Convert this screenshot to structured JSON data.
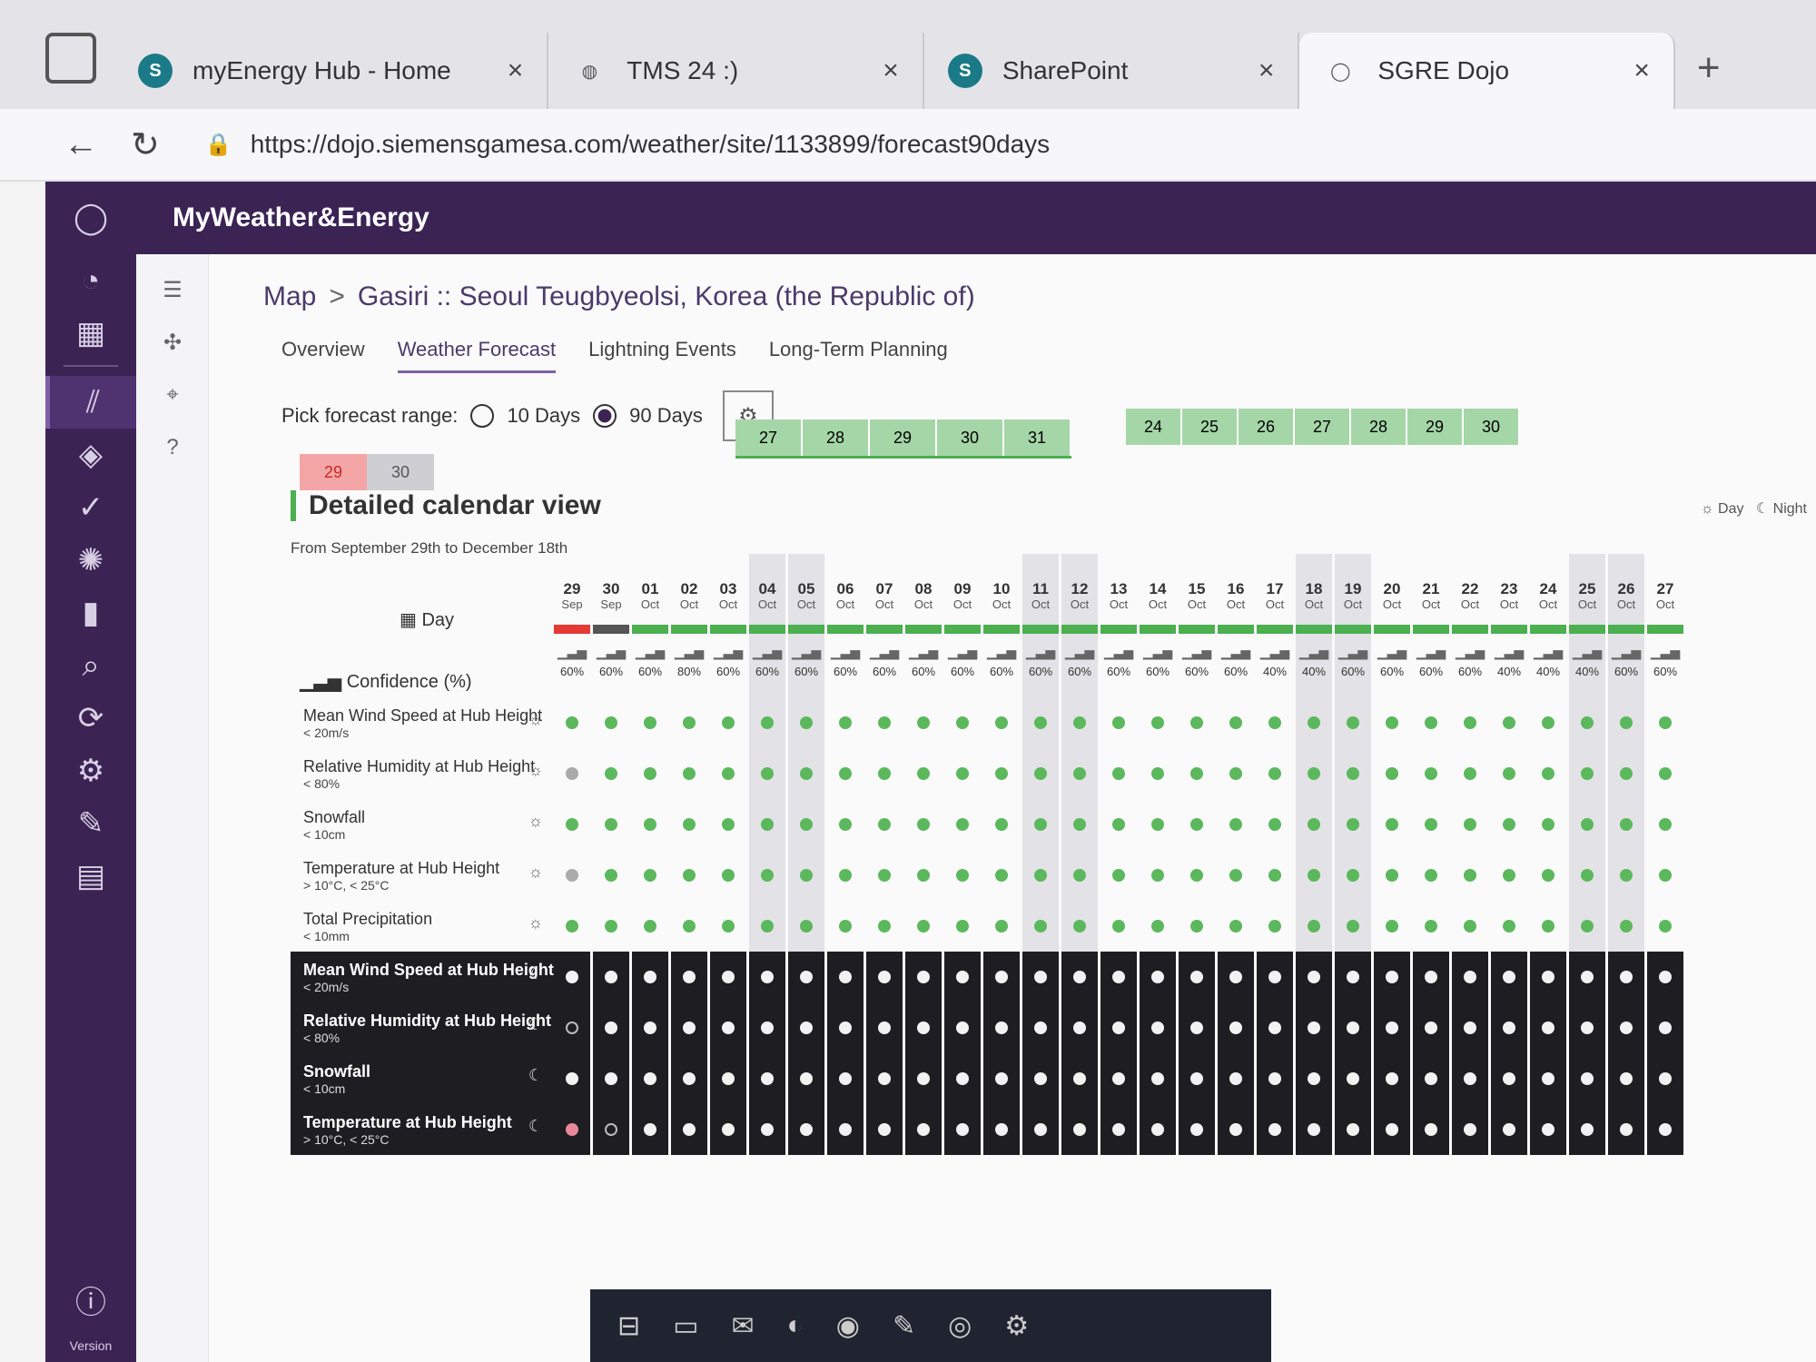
{
  "browser": {
    "tabs": [
      {
        "title": "myEnergy Hub - Home",
        "icon": "sharepoint-icon",
        "color": "#1b7a88"
      },
      {
        "title": "TMS 24 :)",
        "icon": "globe-icon",
        "color": "#555555"
      },
      {
        "title": "SharePoint",
        "icon": "sharepoint-icon",
        "color": "#1b7a88"
      },
      {
        "title": "SGRE Dojo",
        "icon": "dojo-icon",
        "color": "#555555"
      }
    ],
    "url": "https://dojo.siemensgamesa.com/weather/site/1133899/forecast90days"
  },
  "app": {
    "title": "MyWeather&Energy",
    "version_label": "Version",
    "breadcrumb": {
      "root": "Map",
      "current": "Gasiri :: Seoul Teugbyeolsi, Korea (the Republic of)"
    },
    "tabs": [
      "Overview",
      "Weather Forecast",
      "Lightning Events",
      "Long-Term Planning"
    ],
    "active_tab": "Weather Forecast",
    "range": {
      "label": "Pick forecast range:",
      "opt10": "10 Days",
      "opt90": "90 Days",
      "selected": "90 Days"
    },
    "mini_calendar": {
      "sep": [
        "29",
        "30"
      ],
      "oct": [
        "27",
        "28",
        "29",
        "30",
        "31"
      ],
      "nov": [
        "24",
        "25",
        "26",
        "27",
        "28",
        "29",
        "30"
      ]
    },
    "section_title": "Detailed calendar view",
    "range_text": "From September 29th to December 18th",
    "legend": {
      "day": "Day",
      "night": "Night"
    },
    "day_label": "Day",
    "confidence_label": "Confidence (%)",
    "colors": {
      "green": "#4caf50",
      "red": "#e53935",
      "grey": "#555555",
      "purple": "#3b2454"
    }
  },
  "days": [
    {
      "d": "29",
      "m": "Sep",
      "conf": "60%",
      "bar": "red"
    },
    {
      "d": "30",
      "m": "Sep",
      "conf": "60%",
      "bar": "grey"
    },
    {
      "d": "01",
      "m": "Oct",
      "conf": "60%",
      "bar": "green"
    },
    {
      "d": "02",
      "m": "Oct",
      "conf": "80%",
      "bar": "green"
    },
    {
      "d": "03",
      "m": "Oct",
      "conf": "60%",
      "bar": "green"
    },
    {
      "d": "04",
      "m": "Oct",
      "conf": "60%",
      "bar": "green",
      "weekend": true
    },
    {
      "d": "05",
      "m": "Oct",
      "conf": "60%",
      "bar": "green",
      "weekend": true
    },
    {
      "d": "06",
      "m": "Oct",
      "conf": "60%",
      "bar": "green"
    },
    {
      "d": "07",
      "m": "Oct",
      "conf": "60%",
      "bar": "green"
    },
    {
      "d": "08",
      "m": "Oct",
      "conf": "60%",
      "bar": "green"
    },
    {
      "d": "09",
      "m": "Oct",
      "conf": "60%",
      "bar": "green"
    },
    {
      "d": "10",
      "m": "Oct",
      "conf": "60%",
      "bar": "green"
    },
    {
      "d": "11",
      "m": "Oct",
      "conf": "60%",
      "bar": "green",
      "weekend": true
    },
    {
      "d": "12",
      "m": "Oct",
      "conf": "60%",
      "bar": "green",
      "weekend": true
    },
    {
      "d": "13",
      "m": "Oct",
      "conf": "60%",
      "bar": "green"
    },
    {
      "d": "14",
      "m": "Oct",
      "conf": "60%",
      "bar": "green"
    },
    {
      "d": "15",
      "m": "Oct",
      "conf": "60%",
      "bar": "green"
    },
    {
      "d": "16",
      "m": "Oct",
      "conf": "60%",
      "bar": "green"
    },
    {
      "d": "17",
      "m": "Oct",
      "conf": "40%",
      "bar": "green"
    },
    {
      "d": "18",
      "m": "Oct",
      "conf": "40%",
      "bar": "green",
      "weekend": true
    },
    {
      "d": "19",
      "m": "Oct",
      "conf": "60%",
      "bar": "green",
      "weekend": true
    },
    {
      "d": "20",
      "m": "Oct",
      "conf": "60%",
      "bar": "green"
    },
    {
      "d": "21",
      "m": "Oct",
      "conf": "60%",
      "bar": "green"
    },
    {
      "d": "22",
      "m": "Oct",
      "conf": "60%",
      "bar": "green"
    },
    {
      "d": "23",
      "m": "Oct",
      "conf": "40%",
      "bar": "green"
    },
    {
      "d": "24",
      "m": "Oct",
      "conf": "40%",
      "bar": "green"
    },
    {
      "d": "25",
      "m": "Oct",
      "conf": "40%",
      "bar": "green",
      "weekend": true
    },
    {
      "d": "26",
      "m": "Oct",
      "conf": "60%",
      "bar": "green",
      "weekend": true
    },
    {
      "d": "27",
      "m": "Oct",
      "conf": "60%",
      "bar": "green"
    }
  ],
  "rows": [
    {
      "label": "Mean Wind Speed at Hub Height",
      "sub": "< 20m/s",
      "period": "day"
    },
    {
      "label": "Relative Humidity at Hub Height",
      "sub": "< 80%",
      "period": "day"
    },
    {
      "label": "Snowfall",
      "sub": "< 10cm",
      "period": "day"
    },
    {
      "label": "Temperature at Hub Height",
      "sub": "> 10°C, < 25°C",
      "period": "day"
    },
    {
      "label": "Total Precipitation",
      "sub": "< 10mm",
      "period": "day"
    },
    {
      "label": "Mean Wind Speed at Hub Height",
      "sub": "< 20m/s",
      "period": "night"
    },
    {
      "label": "Relative Humidity at Hub Height",
      "sub": "< 80%",
      "period": "night"
    },
    {
      "label": "Snowfall",
      "sub": "< 10cm",
      "period": "night"
    },
    {
      "label": "Temperature at Hub Height",
      "sub": "> 10°C, < 25°C",
      "period": "night"
    }
  ],
  "cell_overrides": {
    "0": {
      "0": "green"
    },
    "1": {
      "0": "grey"
    },
    "3": {
      "0": "grey"
    },
    "6": {
      "0": "empty"
    },
    "8": {
      "0": "red",
      "1": "empty"
    }
  }
}
